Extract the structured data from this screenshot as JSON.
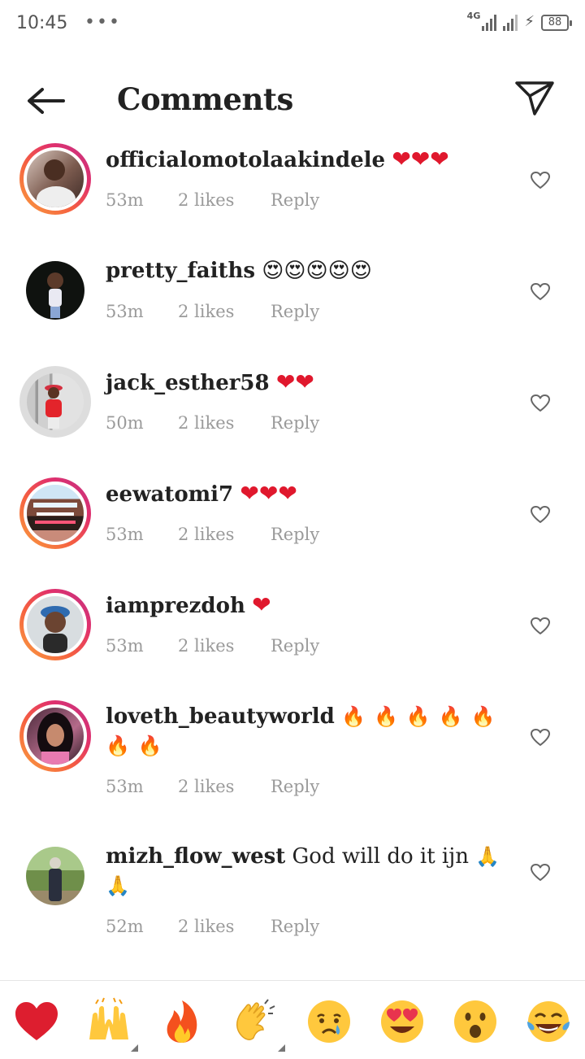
{
  "status_bar": {
    "time": "10:45",
    "dots": "•••",
    "network": "4G",
    "battery": "88"
  },
  "header": {
    "title": "Comments",
    "back_icon": "arrow-left-icon",
    "send_icon": "paper-plane-icon"
  },
  "comments": [
    {
      "username": "officialomotolaakindele",
      "text": "",
      "emojis": "❤❤❤",
      "emoji_type": "heart",
      "time": "53m",
      "likes": "2 likes",
      "reply": "Reply"
    },
    {
      "username": "pretty_faiths",
      "text": "",
      "emojis": "😍😍😍😍😍",
      "emoji_type": "heart-eyes",
      "time": "53m",
      "likes": "2 likes",
      "reply": "Reply"
    },
    {
      "username": "jack_esther58",
      "text": "",
      "emojis": "❤❤",
      "emoji_type": "heart",
      "time": "50m",
      "likes": "2 likes",
      "reply": "Reply"
    },
    {
      "username": "eewatomi7",
      "text": "",
      "emojis": "❤❤❤",
      "emoji_type": "heart",
      "time": "53m",
      "likes": "2 likes",
      "reply": "Reply"
    },
    {
      "username": "iamprezdoh",
      "text": "",
      "emojis": "❤",
      "emoji_type": "heart",
      "time": "53m",
      "likes": "2 likes",
      "reply": "Reply"
    },
    {
      "username": "loveth_beautyworld",
      "text": "",
      "emojis": "🔥🔥🔥🔥🔥🔥🔥",
      "emoji_type": "fire",
      "time": "53m",
      "likes": "2 likes",
      "reply": "Reply"
    },
    {
      "username": "mizh_flow_west",
      "text": "God will do it ijn",
      "emojis": "🙏🙏",
      "emoji_type": "folded-hands",
      "time": "52m",
      "likes": "2 likes",
      "reply": "Reply"
    }
  ],
  "reactions": [
    "red-heart",
    "raising-hands",
    "fire",
    "clapping-hands",
    "crying-face",
    "heart-eyes-face",
    "surprised-face",
    "tears-of-joy-face"
  ],
  "colors": {
    "heart": "#e0182d",
    "story_ring_start": "#f9a03f",
    "story_ring_end": "#c13584",
    "meta_text": "#9a9a9a"
  }
}
